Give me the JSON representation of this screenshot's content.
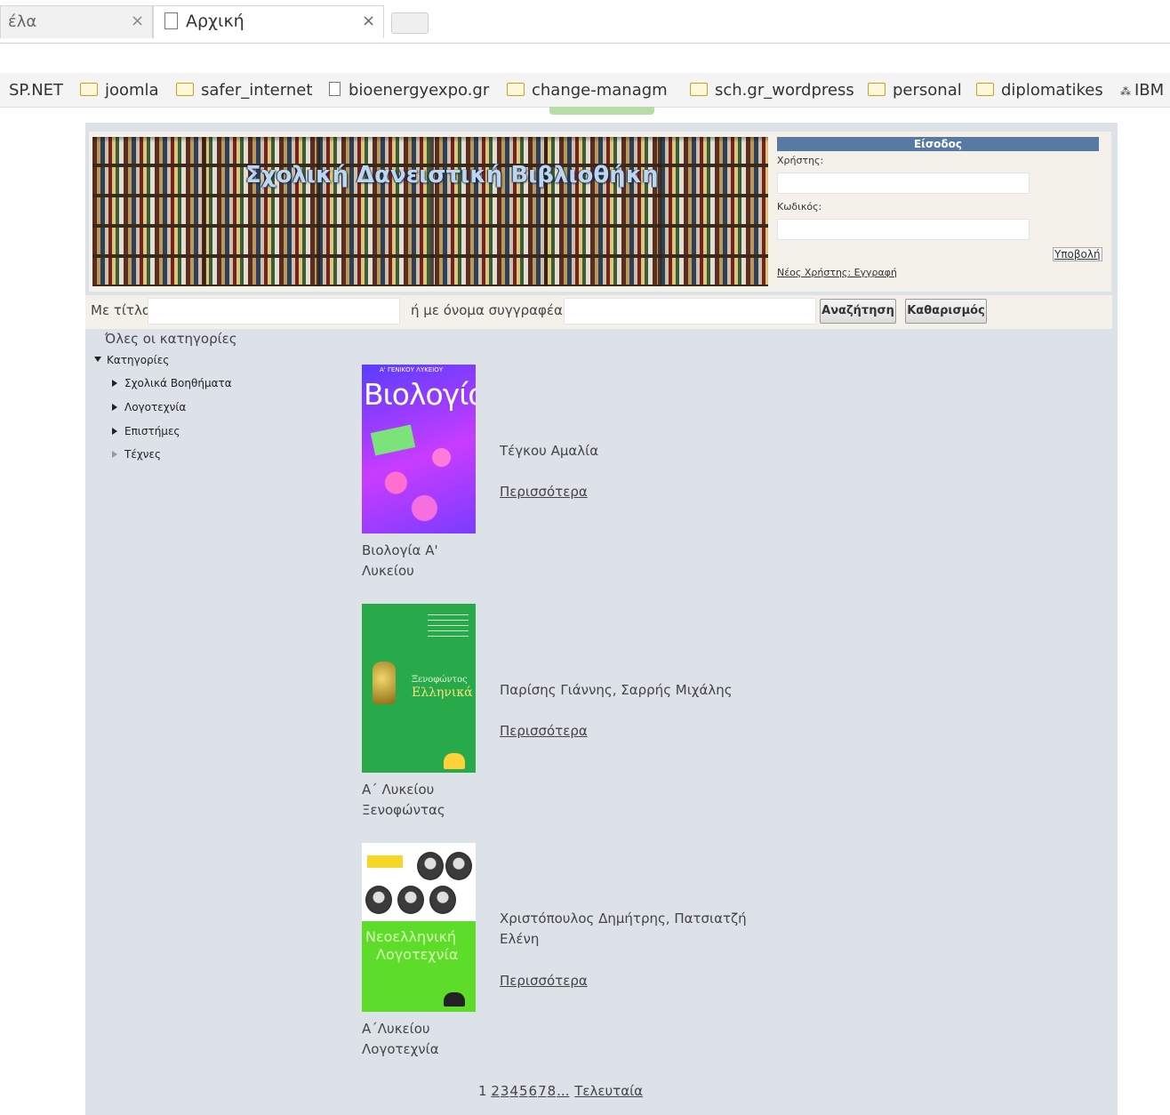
{
  "browser": {
    "tabs": [
      {
        "title": "έλα",
        "close": "×"
      },
      {
        "title": "Αρχική",
        "close": "×"
      }
    ],
    "bookmarks": [
      {
        "label": "SP.NET",
        "icon": "none"
      },
      {
        "label": "joomla",
        "icon": "folder-icon"
      },
      {
        "label": "safer_internet",
        "icon": "folder-icon"
      },
      {
        "label": "bioenergyexpo.gr",
        "icon": "page-icon"
      },
      {
        "label": "change-managm",
        "icon": "folder-icon"
      },
      {
        "label": "sch.gr_wordpress",
        "icon": "folder-icon"
      },
      {
        "label": "personal",
        "icon": "folder-icon"
      },
      {
        "label": "diplomatikes",
        "icon": "folder-icon"
      },
      {
        "label": "IBM",
        "icon": "ibm-icon"
      }
    ]
  },
  "header": {
    "banner_title": "Σχολική Δανειστική Βιβλιοθήκη",
    "login": {
      "title": "Είσοδος",
      "user_label": "Χρήστης:",
      "password_label": "Κωδικός:",
      "submit_label": "Υποβολή",
      "new_user": "Νέος Χρήστης: Εγγραφή"
    }
  },
  "search": {
    "title_label": "Με τίτλο",
    "author_label": "ή με όνομα συγγραφέα",
    "search_button": "Αναζήτηση",
    "clear_button": "Καθαρισμός"
  },
  "categories": {
    "all": "Όλες οι κατηγορίες",
    "root": "Κατηγορίες",
    "items": [
      "Σχολικά Βοηθήματα",
      "Λογοτεχνία",
      "Επιστήμες",
      "Τέχνες"
    ]
  },
  "books": [
    {
      "title_line1": "Βιολογία Α'",
      "title_line2": "Λυκείου",
      "author": "Τέγκου Αμαλία",
      "more": "Περισσότερα",
      "cover_text": "Βιολογία",
      "cover_subtext": "Α' ΓΕΝΙΚΟΥ ΛΥΚΕΙΟΥ"
    },
    {
      "title_line1": "Α΄ Λυκείου",
      "title_line2": "Ξενοφώντας",
      "author": "Παρίσης Γιάννης, Σαρρής Μιχάλης",
      "more": "Περισσότερα",
      "cover_text1": "Ξενοφώντος",
      "cover_text2": "Ελληνικά"
    },
    {
      "title_line1": "Α΄Λυκείου",
      "title_line2": "Λογοτεχνία",
      "author_line1": "Χριστόπουλος Δημήτρης, Πατσιατζή",
      "author_line2": "Ελένη",
      "more": "Περισσότερα",
      "cover_text1": "Νεοελληνική",
      "cover_text2": "Λογοτεχνία"
    }
  ],
  "pagination": {
    "current": "1",
    "pages": [
      "2",
      "3",
      "4",
      "5",
      "6",
      "7",
      "8"
    ],
    "ellipsis": "...",
    "last": "Τελευταία"
  }
}
